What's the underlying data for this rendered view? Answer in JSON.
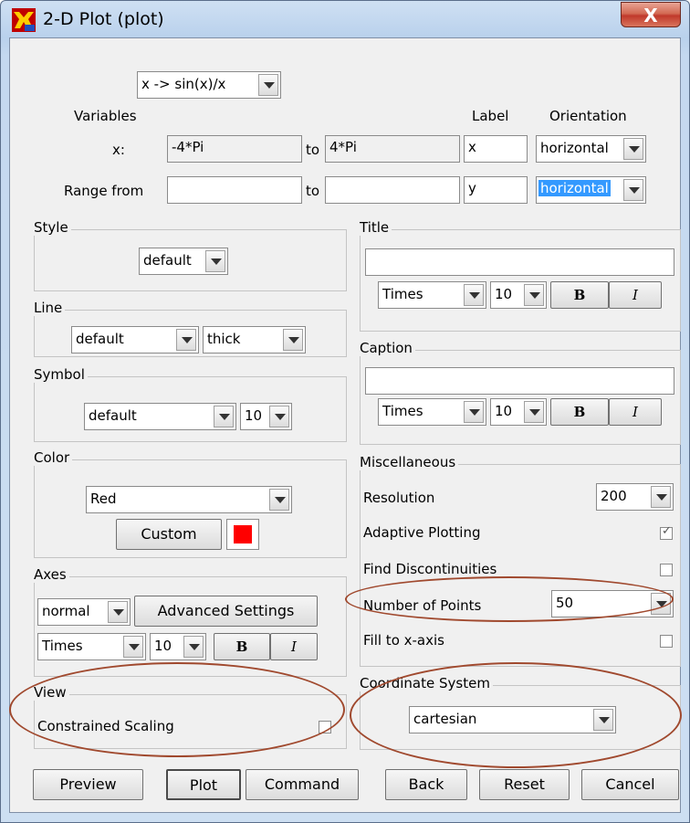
{
  "window": {
    "title": "2-D Plot (plot)",
    "close_label": "X"
  },
  "function_select": {
    "value": "x -> sin(x)/x"
  },
  "header": {
    "variables": "Variables",
    "label": "Label",
    "orientation": "Orientation"
  },
  "x_row": {
    "name": "x:",
    "from": "-4*Pi",
    "to_label": "to",
    "to": "4*Pi",
    "label": "x",
    "orientation": "horizontal"
  },
  "range_row": {
    "name": "Range from",
    "from": "",
    "to_label": "to",
    "to": "",
    "label": "y",
    "orientation": "horizontal"
  },
  "style": {
    "title": "Style",
    "value": "default"
  },
  "line": {
    "title": "Line",
    "style": "default",
    "width": "thick"
  },
  "symbol": {
    "title": "Symbol",
    "value": "default",
    "size": "10"
  },
  "color": {
    "title": "Color",
    "value": "Red",
    "custom_label": "Custom",
    "swatch": "#ff0000"
  },
  "axes": {
    "title": "Axes",
    "value": "normal",
    "advanced_label": "Advanced Settings",
    "font": "Times",
    "size": "10",
    "bold": "B",
    "italic": "I"
  },
  "view": {
    "title": "View",
    "constrained_label": "Constrained Scaling",
    "constrained": false
  },
  "plot_title": {
    "title": "Title",
    "value": "",
    "font": "Times",
    "size": "10",
    "bold": "B",
    "italic": "I"
  },
  "caption": {
    "title": "Caption",
    "value": "",
    "font": "Times",
    "size": "10",
    "bold": "B",
    "italic": "I"
  },
  "misc": {
    "title": "Miscellaneous",
    "resolution_label": "Resolution",
    "resolution": "200",
    "adaptive_label": "Adaptive Plotting",
    "adaptive": true,
    "discont_label": "Find Discontinuities",
    "discont": false,
    "points_label": "Number of Points",
    "points": "50",
    "fill_label": "Fill to x-axis",
    "fill": false
  },
  "coords": {
    "title": "Coordinate System",
    "value": "cartesian"
  },
  "buttons": {
    "preview": "Preview",
    "plot": "Plot",
    "command": "Command",
    "back": "Back",
    "reset": "Reset",
    "cancel": "Cancel"
  },
  "colors": {
    "annotation": "#a0492e",
    "selection": "#3399ff"
  }
}
